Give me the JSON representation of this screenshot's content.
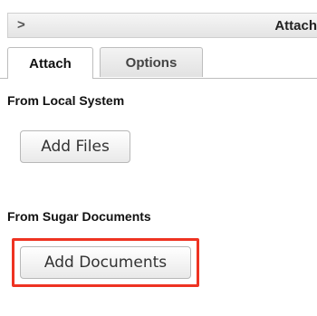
{
  "header": {
    "chevron": ">",
    "title": "Attach"
  },
  "tabs": [
    {
      "label": "Attach",
      "active": true
    },
    {
      "label": "Options",
      "active": false
    }
  ],
  "local": {
    "label": "From Local System",
    "button": "Add Files"
  },
  "sugar": {
    "label": "From Sugar Documents",
    "button": "Add Documents"
  },
  "colors": {
    "highlight": "#ee3322"
  }
}
